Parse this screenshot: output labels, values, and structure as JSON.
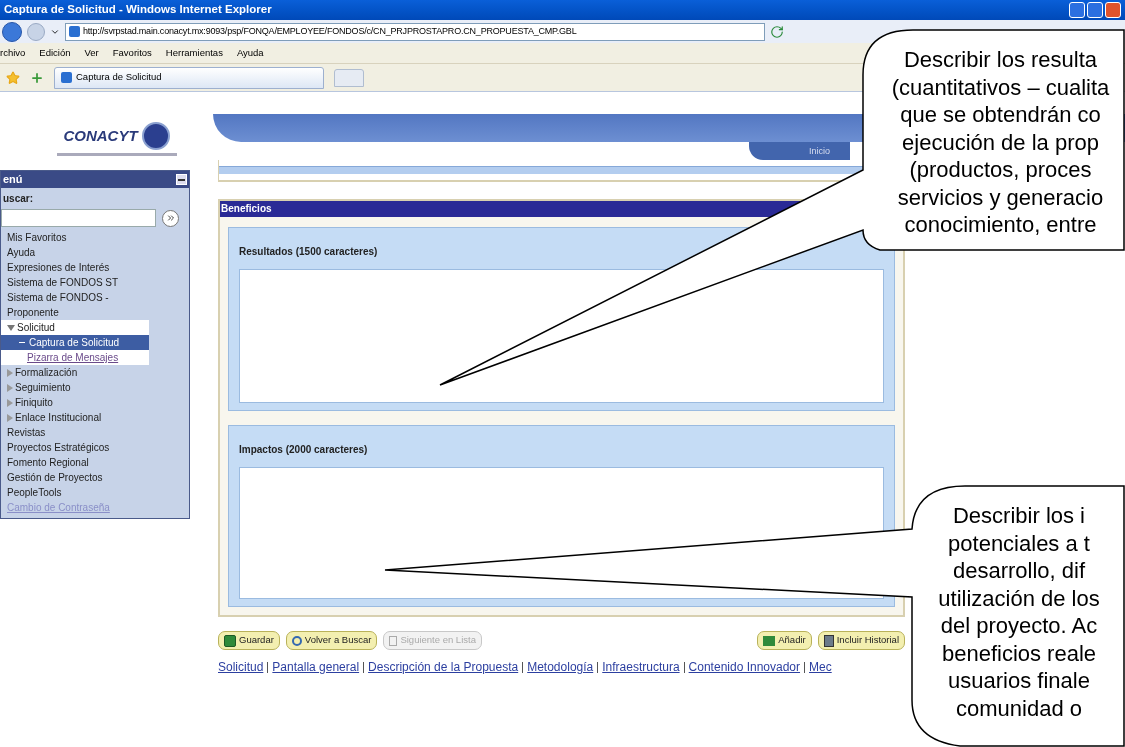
{
  "window": {
    "title": "Captura de Solicitud - Windows Internet Explorer"
  },
  "address_bar": {
    "url": "http://svrpstad.main.conacyt.mx:9093/psp/FONQA/EMPLOYEE/FONDOS/c/CN_PRJPROSTAPRO.CN_PROPUESTA_CMP.GBL"
  },
  "menu_bar": [
    "rchivo",
    "Edición",
    "Ver",
    "Favoritos",
    "Herramientas",
    "Ayuda"
  ],
  "browser_tab": {
    "label": "Captura de Solicitud"
  },
  "site": {
    "logo": "CONACYT",
    "header_tab": "Inicio"
  },
  "sidebar": {
    "title": "enú",
    "search_label": "uscar:",
    "items": [
      {
        "label": "Mis Favoritos",
        "kind": "plain"
      },
      {
        "label": "Ayuda",
        "kind": "plain"
      },
      {
        "label": "Expresiones de Interés",
        "kind": "plain"
      },
      {
        "label": "Sistema de FONDOS ST",
        "kind": "plain"
      },
      {
        "label": "Sistema de FONDOS - Proponente",
        "kind": "plain"
      },
      {
        "label": "Solicitud",
        "kind": "folder",
        "expanded": true,
        "children": [
          {
            "label": "Captura de Solicitud",
            "kind": "leaf",
            "selected": true
          },
          {
            "label": "Pizarra de Mensajes",
            "kind": "link",
            "selected": false
          }
        ]
      },
      {
        "label": "Formalización",
        "kind": "folder",
        "expanded": false
      },
      {
        "label": "Seguimiento",
        "kind": "folder",
        "expanded": false
      },
      {
        "label": "Finiquito",
        "kind": "folder",
        "expanded": false
      },
      {
        "label": "Enlace Institucional",
        "kind": "folder",
        "expanded": false
      },
      {
        "label": "Revistas",
        "kind": "plain"
      },
      {
        "label": "Proyectos Estratégicos",
        "kind": "plain"
      },
      {
        "label": "Fomento Regional",
        "kind": "plain"
      },
      {
        "label": "Gestión de Proyectos",
        "kind": "plain"
      },
      {
        "label": "PeopleTools",
        "kind": "plain"
      },
      {
        "label": "Cambio de Contraseña",
        "kind": "link"
      }
    ]
  },
  "section": {
    "title": "Beneficios",
    "fields": [
      {
        "label": "Resultados (1500 caracteres)"
      },
      {
        "label": "Impactos (2000 caracteres)"
      }
    ]
  },
  "buttons": [
    {
      "label": "Guardar",
      "kind": "save",
      "disabled": false
    },
    {
      "label": "Volver a Buscar",
      "kind": "search",
      "disabled": false
    },
    {
      "label": "Siguiente en Lista",
      "kind": "next",
      "disabled": true
    },
    {
      "label": "Añadir",
      "kind": "add",
      "disabled": false
    },
    {
      "label": "Incluir Historial",
      "kind": "history",
      "disabled": false
    }
  ],
  "page_links": [
    "Solicitud",
    "Pantalla general",
    "Descripción de la Propuesta",
    "Metodología",
    "Infraestructura",
    "Contenido Innovador",
    "Mec"
  ],
  "callouts": [
    {
      "lines": [
        "Describir los resulta",
        "(cuantitativos – cualita",
        "que se obtendrán co",
        "ejecución de la prop",
        "(productos, proces",
        "servicios y generacio",
        "conocimiento, entre"
      ]
    },
    {
      "lines": [
        "Describir los i",
        "potenciales a t",
        "desarrollo, dif",
        "utilización de los",
        "del proyecto. Ac",
        "beneficios reale",
        "usuarios finale",
        "comunidad o"
      ]
    }
  ]
}
